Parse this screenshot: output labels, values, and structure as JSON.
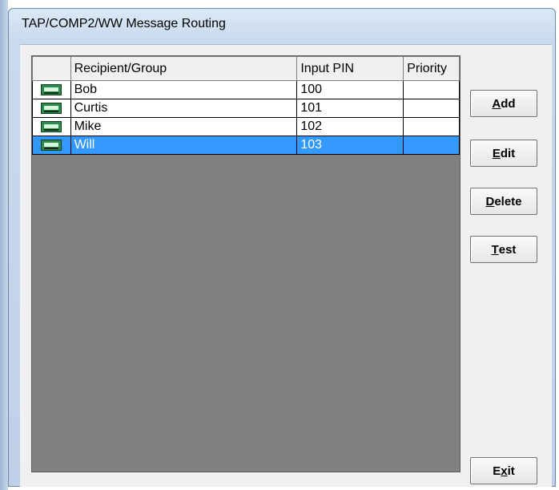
{
  "window": {
    "title": "TAP/COMP2/WW Message Routing"
  },
  "table": {
    "columns": [
      "",
      "Recipient/Group",
      "Input PIN",
      "Priority"
    ],
    "rows": [
      {
        "icon": "pager-icon",
        "name": "Bob",
        "pin": "100",
        "priority": ""
      },
      {
        "icon": "pager-icon",
        "name": "Curtis",
        "pin": "101",
        "priority": ""
      },
      {
        "icon": "pager-icon",
        "name": "Mike",
        "pin": "102",
        "priority": ""
      },
      {
        "icon": "pager-icon",
        "name": "Will",
        "pin": "103",
        "priority": "",
        "selected": true
      }
    ]
  },
  "buttons": {
    "add": {
      "accel": "A",
      "rest": "dd"
    },
    "edit": {
      "accel": "E",
      "rest": "dit"
    },
    "delete": {
      "accel": "D",
      "rest": "elete"
    },
    "test": {
      "accel": "T",
      "rest": "est"
    },
    "exit": {
      "pre": "E",
      "accel": "x",
      "rest": "it"
    }
  },
  "colors": {
    "selection": "#3399ff",
    "grid_background": "#808080",
    "pager_icon": "#2c8a4a"
  }
}
